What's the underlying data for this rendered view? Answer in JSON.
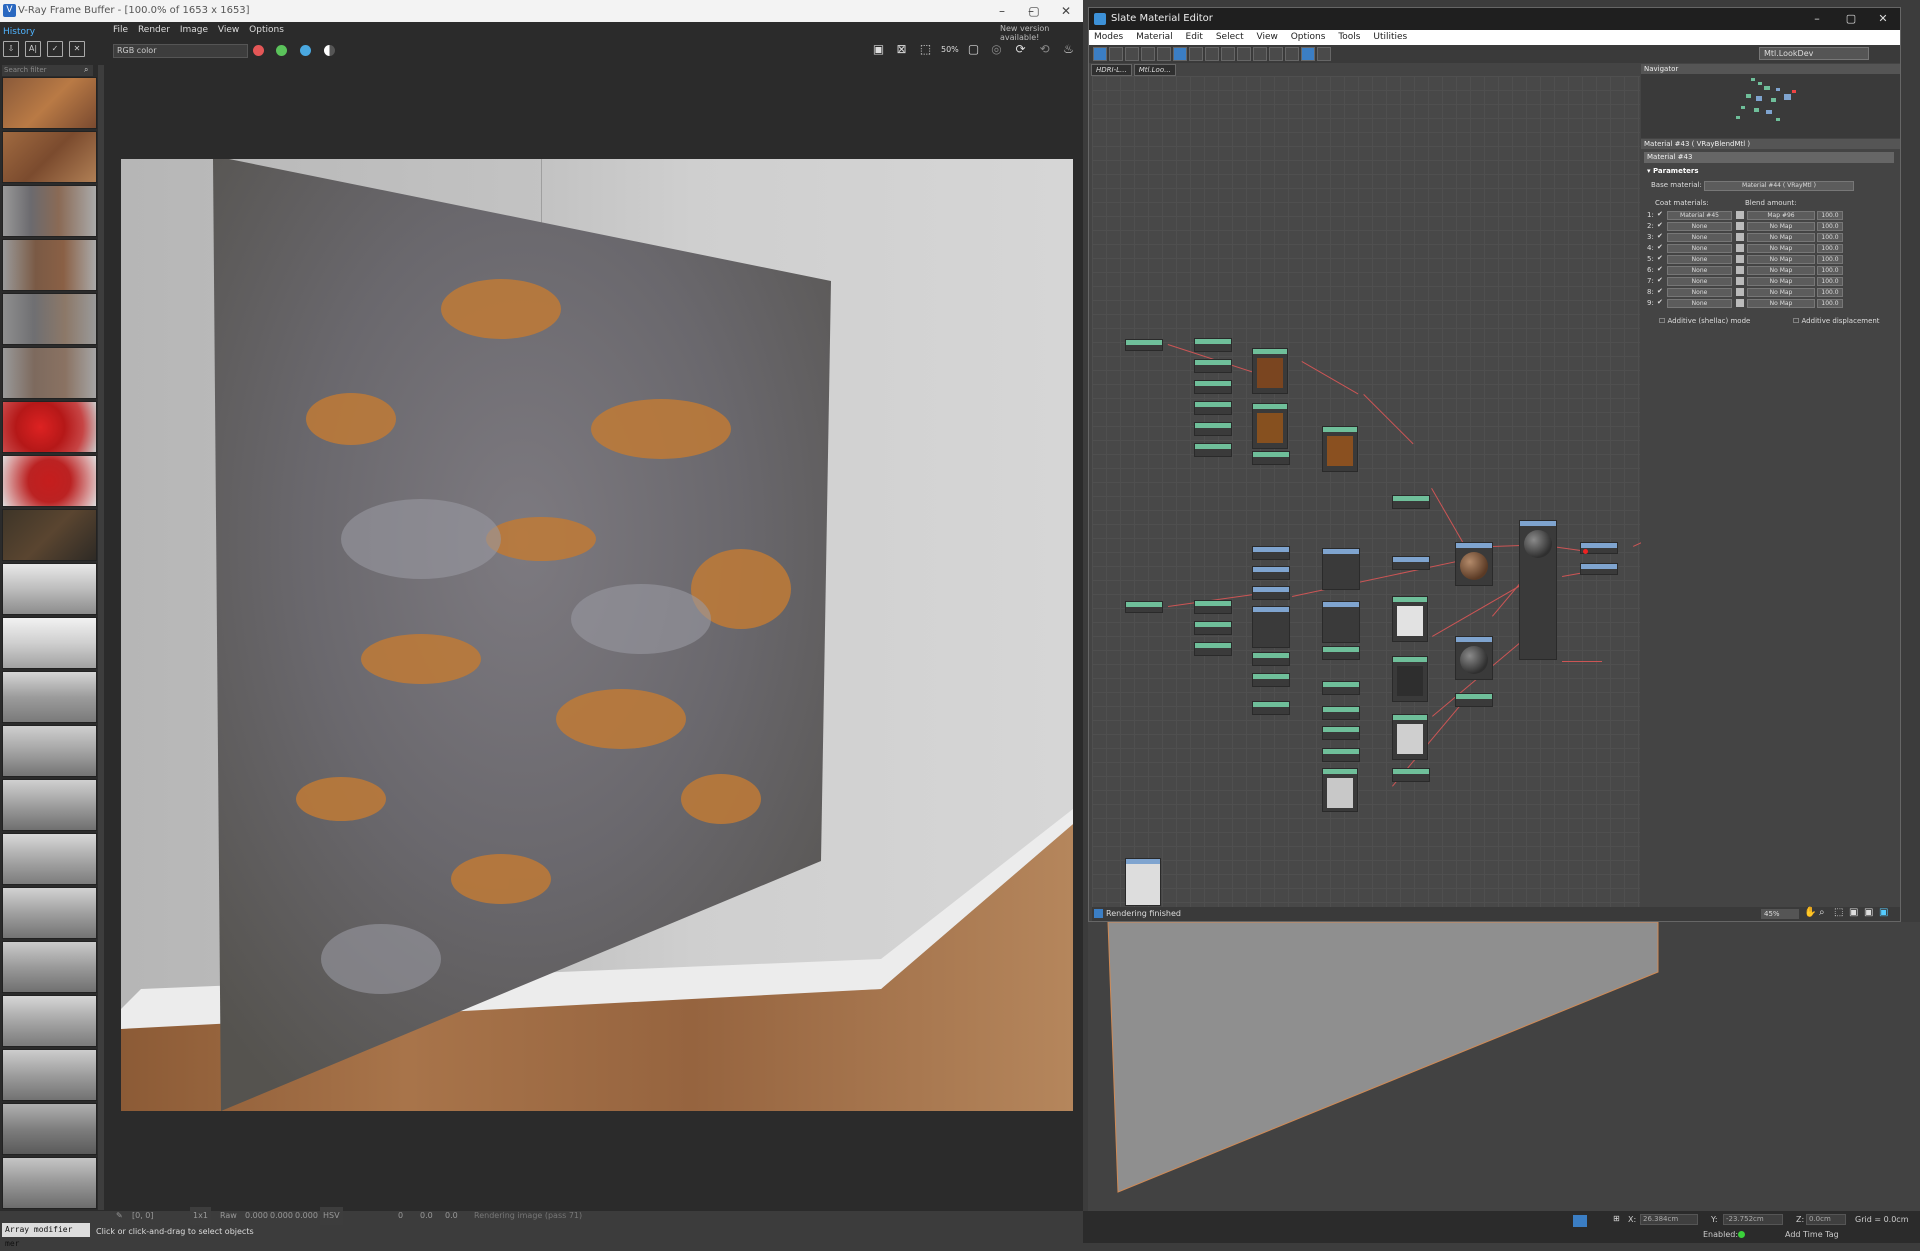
{
  "vfb": {
    "title": "V-Ray Frame Buffer - [100.0% of 1653 x 1653]",
    "menu": [
      "File",
      "Render",
      "Image",
      "View",
      "Options"
    ],
    "new_version": "New version available!",
    "history_label": "History",
    "search_placeholder": "Search filter",
    "channel": "RGB color",
    "status": {
      "coords": "[0, 0]",
      "ratio": "1x1",
      "raw_label": "Raw",
      "raw_values": [
        "0.000",
        "0.000",
        "0.000"
      ],
      "color_mode": "HSV",
      "hsv_values": [
        "0",
        "0.0",
        "0.0"
      ],
      "progress": "Rendering image (pass 71)"
    }
  },
  "slate": {
    "title": "Slate Material Editor",
    "menu": [
      "Modes",
      "Material",
      "Edit",
      "Select",
      "View",
      "Options",
      "Tools",
      "Utilities"
    ],
    "material_select": "Mtl.LookDev",
    "tabs": [
      "HDRI-L...",
      "Mtl.Loo..."
    ],
    "navigator_label": "Navigator",
    "params_header": "Material #43  ( VRayBlendMtl )",
    "material_name": "Material #43",
    "section_title": "Parameters",
    "base_label": "Base material:",
    "base_value": "Material #44  ( VRayMtl )",
    "coat_label": "Coat materials:",
    "blend_label": "Blend amount:",
    "coat_rows": [
      {
        "index": "1:",
        "coat": "Material #45",
        "map": "Map #96",
        "amount": "100.0"
      },
      {
        "index": "2:",
        "coat": "None",
        "map": "No Map",
        "amount": "100.0"
      },
      {
        "index": "3:",
        "coat": "None",
        "map": "No Map",
        "amount": "100.0"
      },
      {
        "index": "4:",
        "coat": "None",
        "map": "No Map",
        "amount": "100.0"
      },
      {
        "index": "5:",
        "coat": "None",
        "map": "No Map",
        "amount": "100.0"
      },
      {
        "index": "6:",
        "coat": "None",
        "map": "No Map",
        "amount": "100.0"
      },
      {
        "index": "7:",
        "coat": "None",
        "map": "No Map",
        "amount": "100.0"
      },
      {
        "index": "8:",
        "coat": "None",
        "map": "No Map",
        "amount": "100.0"
      },
      {
        "index": "9:",
        "coat": "None",
        "map": "No Map",
        "amount": "100.0"
      }
    ],
    "additive_shellac": "Additive (shellac) mode",
    "additive_disp": "Additive displacement",
    "status": "Rendering finished",
    "zoom": "45%"
  },
  "viewport_status": {
    "x_label": "X:",
    "x_value": "26.384cm",
    "y_label": "Y:",
    "y_value": "-23.752cm",
    "z_label": "Z:",
    "z_value": "0.0cm",
    "grid": "Grid = 0.0cm",
    "enabled": "Enabled:",
    "add_time_tag": "Add Time Tag",
    "array_modifier": "Array modifier mer",
    "hint": "Click or click-and-drag to select objects"
  }
}
